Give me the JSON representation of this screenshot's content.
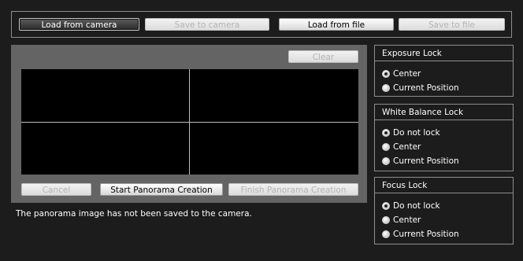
{
  "toolbar": {
    "load_from_camera": "Load from camera",
    "save_to_camera": "Save to camera",
    "load_from_file": "Load from file",
    "save_to_file": "Save to file"
  },
  "preview": {
    "clear": "Clear",
    "cancel": "Cancel",
    "start": "Start Panorama Creation",
    "finish": "Finish Panorama Creation",
    "status": "The panorama image has not been saved to the camera."
  },
  "exposure_lock": {
    "title": "Exposure Lock",
    "options": [
      "Center",
      "Current Position"
    ],
    "selected": "Center"
  },
  "white_balance_lock": {
    "title": "White Balance Lock",
    "options": [
      "Do not lock",
      "Center",
      "Current Position"
    ],
    "selected": "Do not lock"
  },
  "focus_lock": {
    "title": "Focus Lock",
    "options": [
      "Do not lock",
      "Center",
      "Current Position"
    ],
    "selected": "Do not lock"
  }
}
